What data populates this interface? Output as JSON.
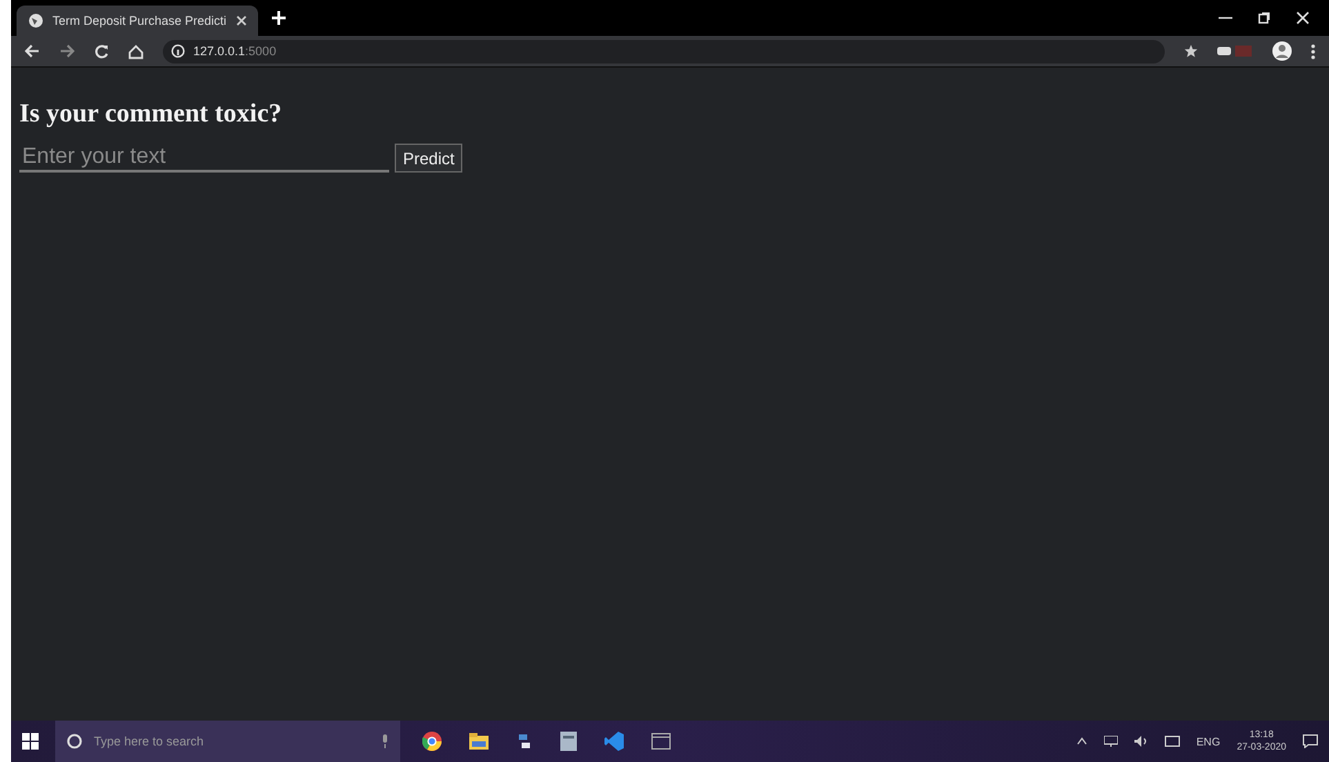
{
  "browser": {
    "tab_title": "Term Deposit Purchase Predicti",
    "url_host": "127.0.0.1",
    "url_port": ":5000"
  },
  "page": {
    "heading": "Is your comment toxic?",
    "input": {
      "placeholder": "Enter your text"
    },
    "button": "Predict"
  },
  "taskbar": {
    "search_placeholder": "Type here to search",
    "language": "ENG",
    "time": "13:18",
    "date": "27-03-2020"
  }
}
